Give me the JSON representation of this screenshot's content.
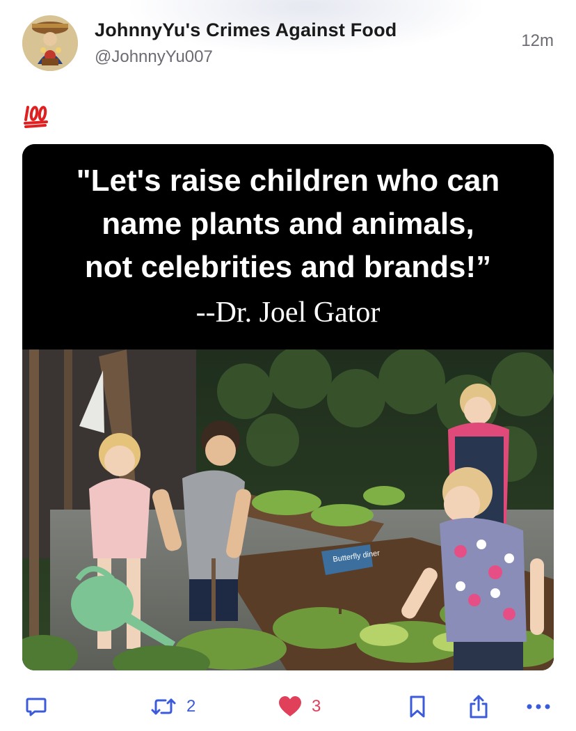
{
  "post": {
    "author_name": "JohnnyYu's Crimes Against Food",
    "handle": "@JohnnyYu007",
    "time": "12m",
    "emoji": "💯"
  },
  "media": {
    "quote": "\"Let's raise children who can\nname plants and animals,\nnot celebrities and brands!”",
    "author": "--Dr. Joel Gator",
    "sign_text": "Butterfly diner"
  },
  "actions": {
    "reply_icon": "speech-bubble-icon",
    "repost_icon": "repost-arrows-icon",
    "repost_count": "2",
    "like_icon": "heart-icon",
    "like_count": "3",
    "bookmark_icon": "bookmark-icon",
    "share_icon": "share-icon",
    "more_icon": "ellipsis-icon"
  },
  "colors": {
    "accent": "#3b5bdb",
    "like": "#e0405a",
    "muted": "#6b6b73"
  }
}
